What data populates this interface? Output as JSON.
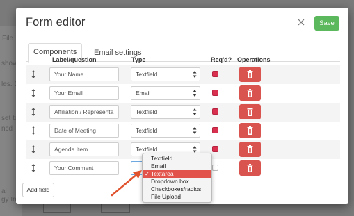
{
  "modal": {
    "title": "Form editor",
    "save_label": "Save",
    "tabs": [
      {
        "label": "Components",
        "active": true
      },
      {
        "label": "Email settings",
        "active": false
      }
    ],
    "columns": {
      "label": "Label/question",
      "type": "Type",
      "required": "Req'd?",
      "operations": "Operations"
    },
    "rows": [
      {
        "label": "Your Name",
        "type": "Textfield",
        "required": true
      },
      {
        "label": "Your Email",
        "type": "Email",
        "required": true
      },
      {
        "label": "Affiliation / Representa",
        "type": "Textfield",
        "required": true
      },
      {
        "label": "Date of Meeting",
        "type": "Textfield",
        "required": true
      },
      {
        "label": "Agenda Item",
        "type": "Textfield",
        "required": true
      },
      {
        "label": "Your Comment",
        "type": "Textarea",
        "required": false
      }
    ],
    "add_field_label": "Add field",
    "dropdown": {
      "options": [
        "Textfield",
        "Email",
        "Textarea",
        "Dropdown box",
        "Checkboxes/radios",
        "File Upload"
      ],
      "selected": "Textarea",
      "check_glyph": "✓"
    }
  },
  "background": {
    "fragments": [
      "File",
      "show",
      "les. 1",
      "set to fi",
      "ncd",
      "al",
      "gy In"
    ]
  },
  "colors": {
    "save": "#5cb85c",
    "delete": "#d9534f",
    "checkbox": "#d9304f",
    "selected_option": "#e2534b",
    "arrow": "#e0532f"
  },
  "icons": [
    "close-icon",
    "drag-handle-icon",
    "select-arrows-icon",
    "trash-icon",
    "annotation-arrow-icon"
  ]
}
